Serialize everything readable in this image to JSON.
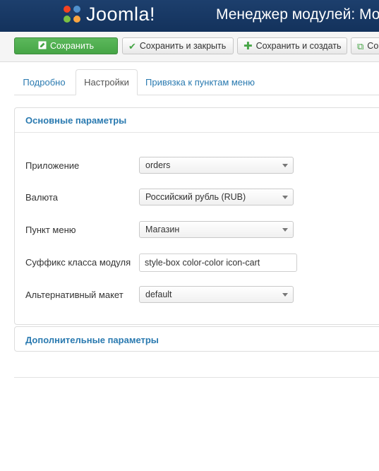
{
  "header": {
    "logo_text": "Joomla!",
    "title": "Менеджер модулей: Мод"
  },
  "toolbar": {
    "save_label": "Сохранить",
    "save_close_label": "Сохранить и закрыть",
    "save_new_label": "Сохранить и создать",
    "copy_label": "Co",
    "icons": {
      "save": "edit-icon",
      "save_close": "check-icon",
      "save_new": "plus-icon",
      "copy": "copy-icon"
    }
  },
  "tabs": [
    {
      "label": "Подробно",
      "active": false
    },
    {
      "label": "Настройки",
      "active": true
    },
    {
      "label": "Привязка к пунктам меню",
      "active": false
    }
  ],
  "basic_params": {
    "title": "Основные параметры",
    "fields": [
      {
        "label": "Приложение",
        "type": "select",
        "value": "orders"
      },
      {
        "label": "Валюта",
        "type": "select",
        "value": "Российский рубль (RUB)"
      },
      {
        "label": "Пункт меню",
        "type": "select",
        "value": "Магазин"
      },
      {
        "label": "Суффикс класса модуля",
        "type": "text",
        "value": "style-box color-color icon-cart"
      },
      {
        "label": "Альтернативный макет",
        "type": "select",
        "value": "default"
      }
    ]
  },
  "advanced_params": {
    "title": "Дополнительные параметры"
  },
  "colors": {
    "header_bg": "#1d3f6d",
    "save_green": "#5cb85c",
    "link_blue": "#2a7ab0"
  }
}
